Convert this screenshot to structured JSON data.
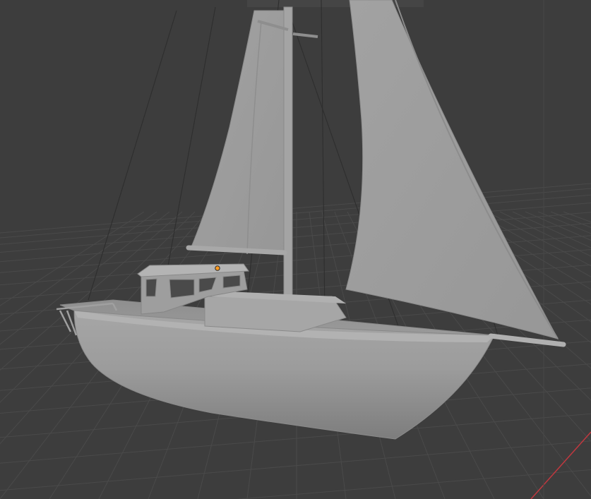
{
  "app": {
    "type": "3d-viewport"
  },
  "viewport": {
    "background": "#3d3d3d",
    "grid_color": "#4a4a4a",
    "x_axis_color": "#c0383f",
    "model_color": "#9e9e9e",
    "selection_origin_color": "#ff9a1f"
  },
  "scene": {
    "objects": [
      "hull",
      "deck",
      "cabin",
      "mast",
      "mainsail",
      "jib",
      "boom",
      "bowsprit",
      "rigging"
    ]
  }
}
